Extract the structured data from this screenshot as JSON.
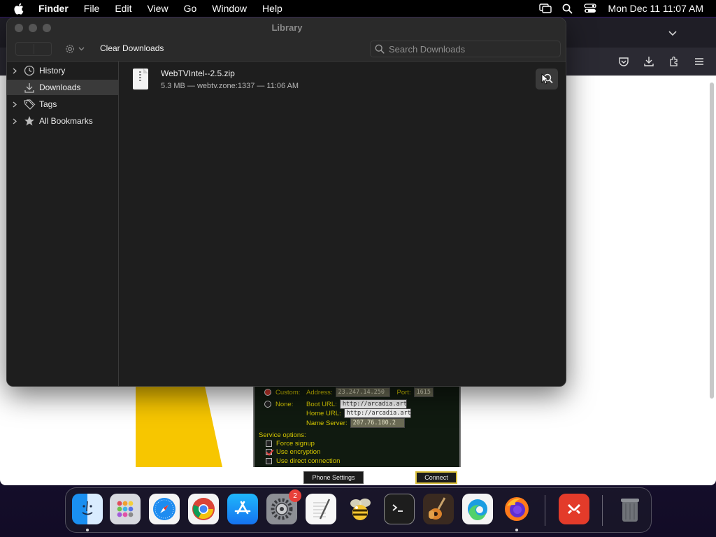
{
  "menubar": {
    "app_name": "Finder",
    "items": [
      "File",
      "Edit",
      "View",
      "Go",
      "Window",
      "Help"
    ],
    "clock": "Mon Dec 11  11:07 AM",
    "status_icons": [
      "screen-mirroring-icon",
      "spotlight-search-icon",
      "control-center-icon"
    ]
  },
  "library": {
    "title": "Library",
    "clear_label": "Clear Downloads",
    "search_placeholder": "Search Downloads",
    "sidebar": [
      {
        "label": "History",
        "icon": "clock-icon",
        "expandable": true,
        "selected": false
      },
      {
        "label": "Downloads",
        "icon": "download-icon",
        "expandable": false,
        "selected": true
      },
      {
        "label": "Tags",
        "icon": "tags-icon",
        "expandable": true,
        "selected": false
      },
      {
        "label": "All Bookmarks",
        "icon": "star-icon",
        "expandable": true,
        "selected": false
      }
    ],
    "downloads": [
      {
        "name": "WebTVIntel--2.5.zip",
        "meta": "5.3 MB — webtv.zone:1337 — 11:06 AM",
        "icon": "zip-file-icon"
      }
    ]
  },
  "webpage": {
    "custom_label": "Custom:",
    "address_label": "Address:",
    "address_value": "23.247.14.250",
    "port_label": "Port:",
    "port_value": "1615",
    "none_label": "None:",
    "boot_url_label": "Boot URL:",
    "boot_url_value": "http://arcadia.artem",
    "home_url_label": "Home URL:",
    "home_url_value": "http://arcadia.artem",
    "name_server_label": "Name Server:",
    "name_server_value": "207.76.180.2",
    "service_options_label": "Service options:",
    "options": [
      {
        "label": "Force signup",
        "checked": false
      },
      {
        "label": "Use encryption",
        "checked": true
      },
      {
        "label": "Use direct connection",
        "checked": false
      }
    ],
    "phone_settings_label": "Phone Settings",
    "connect_label": "Connect"
  },
  "dock": {
    "apps": [
      "Finder",
      "Launchpad",
      "Safari",
      "Google Chrome",
      "App Store",
      "System Settings",
      "TextEdit",
      "Cyberduck",
      "Terminal",
      "GarageBand",
      "Microsoft Edge",
      "Firefox",
      "Parallels Desktop",
      "Trash"
    ],
    "settings_badge": "2"
  }
}
